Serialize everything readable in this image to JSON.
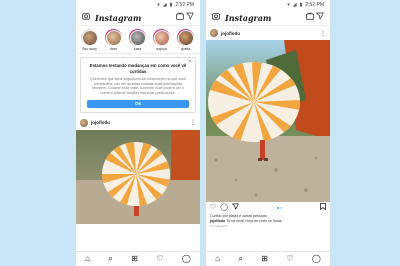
{
  "status_bar": {
    "time": "2:52 PM"
  },
  "app": {
    "logo_text": "Instagram"
  },
  "stories": [
    {
      "name": "Seu story"
    },
    {
      "name": "ifran"
    },
    {
      "name": "luisa"
    },
    {
      "name": "sophia"
    },
    {
      "name": "guelia"
    }
  ],
  "notice": {
    "title": "Estamos testando mudanças em como você vê curtidas",
    "body": "Queremos que seus seguidores se concentrem no que você compartilha, não em quantas curtidas suas publicações recebem. Durante esse teste, somente você poderá ver o número total de curtidas nas suas publicações.",
    "button_label": "Ok",
    "close_icon": "close-icon"
  },
  "post": {
    "username": "jojoflodu",
    "liked_by": "Curtido por jdavid e outras pessoas",
    "caption_user": "jojoflodu",
    "caption_text": "Tô na mira! Hora de curtir os ferias",
    "time": "2 horas atrás"
  },
  "icons": {
    "camera": "camera-icon",
    "igtv": "igtv-icon",
    "direct": "paper-plane-icon",
    "home": "home-icon",
    "search": "search-icon",
    "add": "add-post-icon",
    "activity": "heart-icon",
    "profile": "profile-icon"
  },
  "colors": {
    "accent": "#3897f0",
    "background": "#c9e6f6",
    "umbrella_stripe": "#f2a640"
  }
}
